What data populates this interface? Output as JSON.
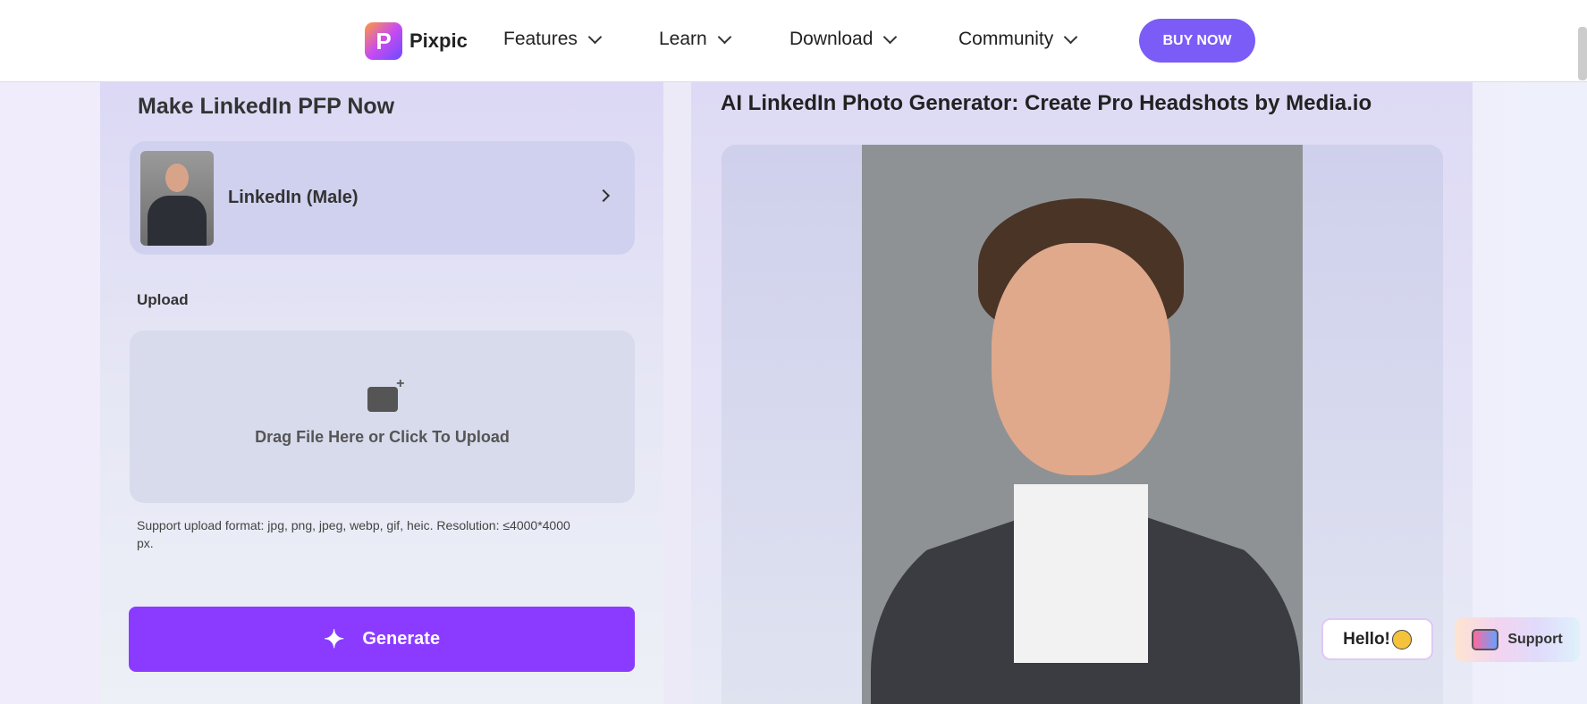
{
  "nav": {
    "brand": "Pixpic",
    "items": [
      "Features",
      "Learn",
      "Download",
      "Community"
    ],
    "buy": "BUY NOW"
  },
  "left": {
    "title": "Make LinkedIn PFP Now",
    "style_label": "LinkedIn (Male)",
    "upload_label": "Upload",
    "drop_text": "Drag File Here or Click To Upload",
    "note": "Support upload format: jpg, png, jpeg, webp, gif, heic. Resolution: ≤4000*4000 px.",
    "generate": "Generate"
  },
  "right": {
    "title": "AI LinkedIn Photo Generator: Create Pro Headshots by Media.io"
  },
  "widgets": {
    "hello": "Hello!",
    "support": "Support"
  },
  "colors": {
    "accent": "#8a3bff",
    "buy": "#7b5cf6"
  }
}
